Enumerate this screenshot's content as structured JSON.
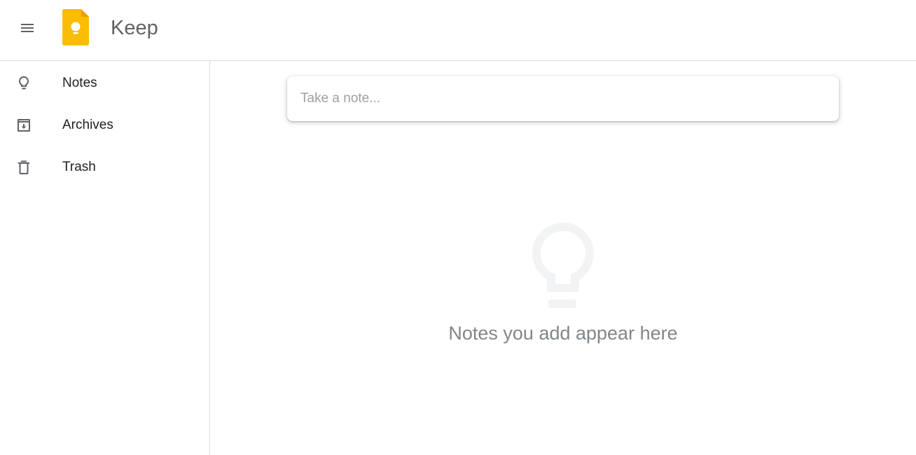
{
  "header": {
    "title": "Keep",
    "menu_icon": "hamburger-menu-icon",
    "logo_icon": "keep-logo-icon"
  },
  "sidebar": {
    "items": [
      {
        "label": "Notes",
        "icon": "lightbulb-icon"
      },
      {
        "label": "Archives",
        "icon": "archive-icon"
      },
      {
        "label": "Trash",
        "icon": "trash-icon"
      }
    ]
  },
  "main": {
    "note_input": {
      "placeholder": "Take a note...",
      "value": ""
    },
    "empty_state": {
      "icon": "lightbulb-icon",
      "text": "Notes you add appear here"
    }
  },
  "colors": {
    "logo_yellow": "#FBBC04",
    "logo_fold": "#F29900",
    "text_secondary": "#5f6368",
    "divider": "#dadce0",
    "empty_icon": "#f1f3f4"
  }
}
